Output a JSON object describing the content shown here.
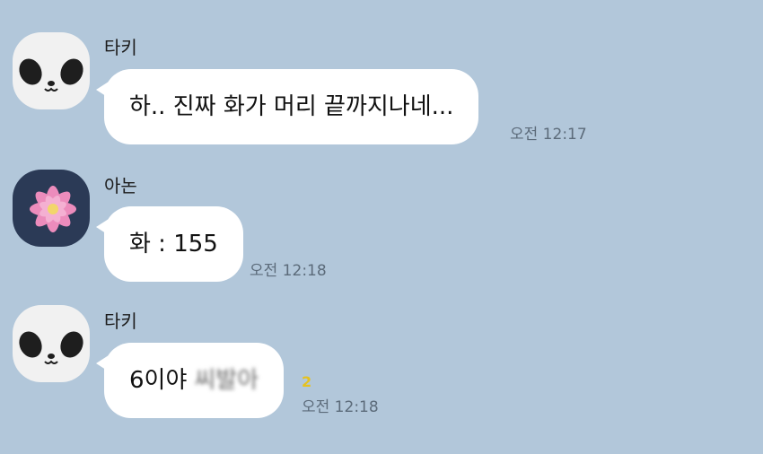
{
  "messages": [
    {
      "sender": "타키",
      "text": "하.. 진짜 화가 머리 끝까지나네...",
      "time": "오전 12:17",
      "avatar_icon": "panda-icon"
    },
    {
      "sender": "아논",
      "text": "화 : 155",
      "time": "오전 12:18",
      "avatar_icon": "lotus-icon"
    },
    {
      "sender": "타키",
      "text": "6이야",
      "censored_text": "씨발아",
      "unread_count": "2",
      "time": "오전 12:18",
      "avatar_icon": "panda-icon"
    }
  ],
  "colors": {
    "background": "#b2c7da",
    "bubble": "#ffffff",
    "unread": "#e6c21f"
  }
}
